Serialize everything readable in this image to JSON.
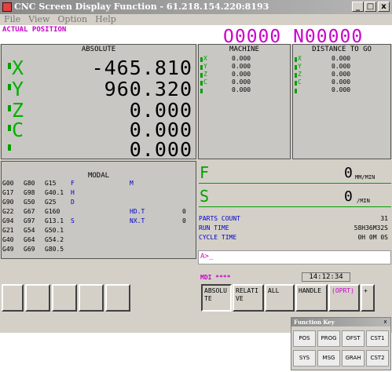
{
  "window": {
    "title": "CNC Screen Display Function - 61.218.154.220:8193",
    "controls": [
      "_",
      "□",
      "x"
    ]
  },
  "menu": [
    "File",
    "View",
    "Option",
    "Help"
  ],
  "header": {
    "label": "ACTUAL POSITION",
    "program": "O0000 N00000"
  },
  "absolute": {
    "title": "ABSOLUTE",
    "axes": [
      {
        "axis": "X",
        "value": "-465.810"
      },
      {
        "axis": "Y",
        "value": "960.320"
      },
      {
        "axis": "Z",
        "value": "0.000"
      },
      {
        "axis": "C",
        "value": "0.000"
      },
      {
        "axis": "",
        "value": "0.000"
      }
    ]
  },
  "machine": {
    "title": "MACHINE",
    "rows": [
      {
        "axis": "X",
        "value": "0.000"
      },
      {
        "axis": "Y",
        "value": "0.000"
      },
      {
        "axis": "Z",
        "value": "0.000"
      },
      {
        "axis": "C",
        "value": "0.000"
      },
      {
        "axis": "",
        "value": "0.000"
      }
    ]
  },
  "distance": {
    "title": "DISTANCE TO GO",
    "rows": [
      {
        "axis": "X",
        "value": "0.000"
      },
      {
        "axis": "Y",
        "value": "0.000"
      },
      {
        "axis": "Z",
        "value": "0.000"
      },
      {
        "axis": "C",
        "value": "0.000"
      },
      {
        "axis": "",
        "value": "0.000"
      }
    ]
  },
  "modal": {
    "title": "MODAL",
    "rows": [
      [
        "G00",
        "G80",
        "G15",
        "F",
        "",
        "M",
        ""
      ],
      [
        "G17",
        "G98",
        "G40.1",
        "H",
        "",
        "",
        ""
      ],
      [
        "G90",
        "G50",
        "G25",
        "D",
        "",
        "",
        ""
      ],
      [
        "G22",
        "G67",
        "G160",
        "",
        "",
        "HD.T",
        "0"
      ],
      [
        "G94",
        "G97",
        "G13.1",
        "S",
        "",
        "NX.T",
        "0"
      ],
      [
        "G21",
        "G54",
        "G50.1",
        "",
        "",
        "",
        ""
      ],
      [
        "G40",
        "G64",
        "G54.2",
        "",
        "",
        "",
        ""
      ],
      [
        "G49",
        "G69",
        "G80.5",
        "",
        "",
        "",
        ""
      ]
    ]
  },
  "feed": {
    "letter": "F",
    "value": "0",
    "unit": "MM/MIN"
  },
  "spindle": {
    "letter": "S",
    "value": "0",
    "unit": "/MIN"
  },
  "counters": [
    {
      "label": "PARTS COUNT",
      "value": "31"
    },
    {
      "label": "RUN TIME",
      "value": "58H36M32S"
    },
    {
      "label": "CYCLE TIME",
      "value": "0H 0M 0S"
    }
  ],
  "input": {
    "prompt": "A>_"
  },
  "status": {
    "mode": "MDI  ****",
    "time": "14:12:34"
  },
  "softkeys": [
    {
      "label": ""
    },
    {
      "label": ""
    },
    {
      "label": ""
    },
    {
      "label": ""
    },
    {
      "label": ""
    },
    {
      "label": "ABSOLUTE"
    },
    {
      "label": "RELATIVE"
    },
    {
      "label": "ALL"
    },
    {
      "label": "HANDLE"
    },
    {
      "label": "(OPRT)"
    },
    {
      "label": "+"
    }
  ],
  "function_key": {
    "title": "Function Key",
    "close": "x",
    "buttons": [
      "POS",
      "PROG",
      "OFST",
      "CST1",
      "SYS",
      "MSG",
      "GRAH",
      "CST2"
    ]
  }
}
